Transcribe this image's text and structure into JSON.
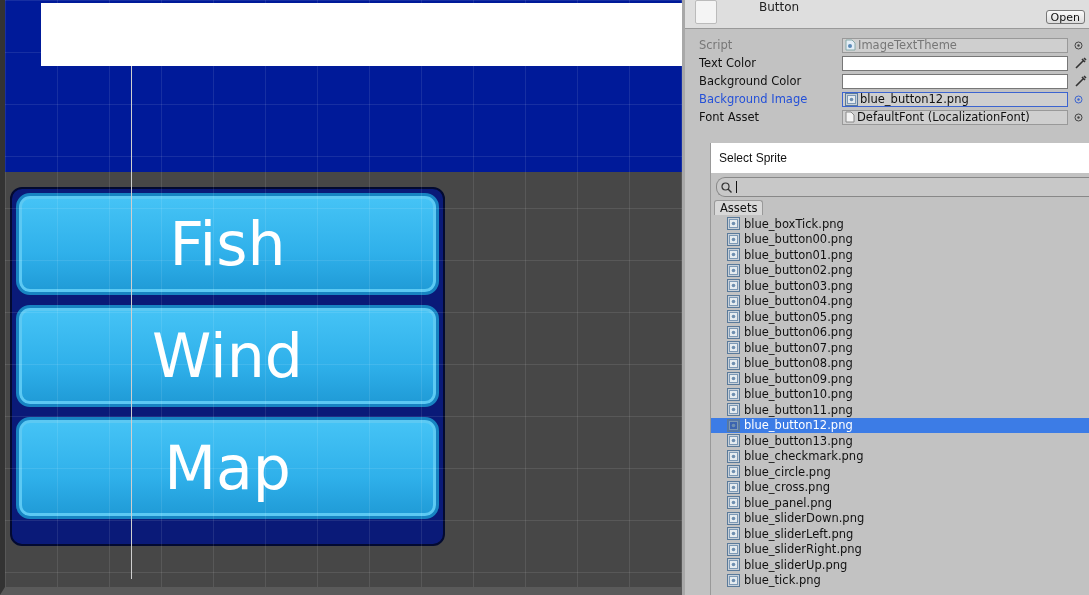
{
  "scene": {
    "buttons": [
      {
        "label": "Fish"
      },
      {
        "label": "Wind"
      },
      {
        "label": "Map"
      }
    ]
  },
  "inspector": {
    "title": "Button",
    "open_button": "Open",
    "properties": [
      {
        "label": "Script",
        "kind": "object",
        "value": "ImageTextTheme",
        "disabled": true,
        "selected": false
      },
      {
        "label": "Text Color",
        "kind": "color",
        "color": "#ffffff",
        "disabled": false,
        "selected": false
      },
      {
        "label": "Background Color",
        "kind": "color",
        "color": "#ffffff",
        "disabled": false,
        "selected": false
      },
      {
        "label": "Background Image",
        "kind": "sprite",
        "value": "blue_button12.png",
        "disabled": false,
        "selected": true
      },
      {
        "label": "Font Asset",
        "kind": "font",
        "value": "DefaultFont (LocalizationFont)",
        "disabled": false,
        "selected": false
      }
    ]
  },
  "sprite_picker": {
    "title": "Select Sprite",
    "tabs": [
      {
        "label": "Assets",
        "selected": true
      }
    ],
    "items": [
      {
        "label": "blue_boxTick.png",
        "selected": false
      },
      {
        "label": "blue_button00.png",
        "selected": false
      },
      {
        "label": "blue_button01.png",
        "selected": false
      },
      {
        "label": "blue_button02.png",
        "selected": false
      },
      {
        "label": "blue_button03.png",
        "selected": false
      },
      {
        "label": "blue_button04.png",
        "selected": false
      },
      {
        "label": "blue_button05.png",
        "selected": false
      },
      {
        "label": "blue_button06.png",
        "selected": false
      },
      {
        "label": "blue_button07.png",
        "selected": false
      },
      {
        "label": "blue_button08.png",
        "selected": false
      },
      {
        "label": "blue_button09.png",
        "selected": false
      },
      {
        "label": "blue_button10.png",
        "selected": false
      },
      {
        "label": "blue_button11.png",
        "selected": false
      },
      {
        "label": "blue_button12.png",
        "selected": true
      },
      {
        "label": "blue_button13.png",
        "selected": false
      },
      {
        "label": "blue_checkmark.png",
        "selected": false
      },
      {
        "label": "blue_circle.png",
        "selected": false
      },
      {
        "label": "blue_cross.png",
        "selected": false
      },
      {
        "label": "blue_panel.png",
        "selected": false
      },
      {
        "label": "blue_sliderDown.png",
        "selected": false
      },
      {
        "label": "blue_sliderLeft.png",
        "selected": false
      },
      {
        "label": "blue_sliderRight.png",
        "selected": false
      },
      {
        "label": "blue_sliderUp.png",
        "selected": false
      },
      {
        "label": "blue_tick.png",
        "selected": false
      }
    ]
  }
}
